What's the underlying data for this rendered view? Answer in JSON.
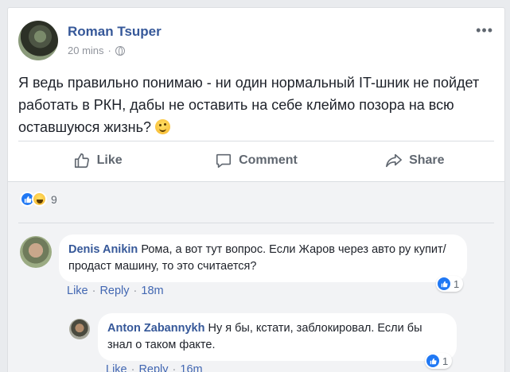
{
  "post": {
    "author": "Roman Tsuper",
    "time": "20 mins",
    "separator": "·",
    "more": "•••",
    "text": "Я ведь правильно понимаю - ни один нормальный IT-шник не пойдет работать в РКН, дабы не оставить на себе клеймо позора на всю оставшуюся жизнь?"
  },
  "actions": {
    "like": "Like",
    "comment": "Comment",
    "share": "Share"
  },
  "reactions": {
    "count": "9"
  },
  "comments": [
    {
      "author": "Denis Anikin",
      "text": "Рома, а вот тут вопрос. Если Жаров через авто ру купит/продаст машину, то это считается?",
      "like_label": "Like",
      "reply_label": "Reply",
      "time": "18m",
      "reaction_count": "1"
    },
    {
      "author": "Anton Zabannykh",
      "text": "Ну я бы, кстати, заблокировал. Если бы знал о таком факте.",
      "like_label": "Like",
      "reply_label": "Reply",
      "time": "16m",
      "reaction_count": "1"
    }
  ],
  "colors": {
    "link": "#365899",
    "action_link": "#4267b2",
    "muted": "#90949c",
    "like_blue": "#2078f4"
  }
}
